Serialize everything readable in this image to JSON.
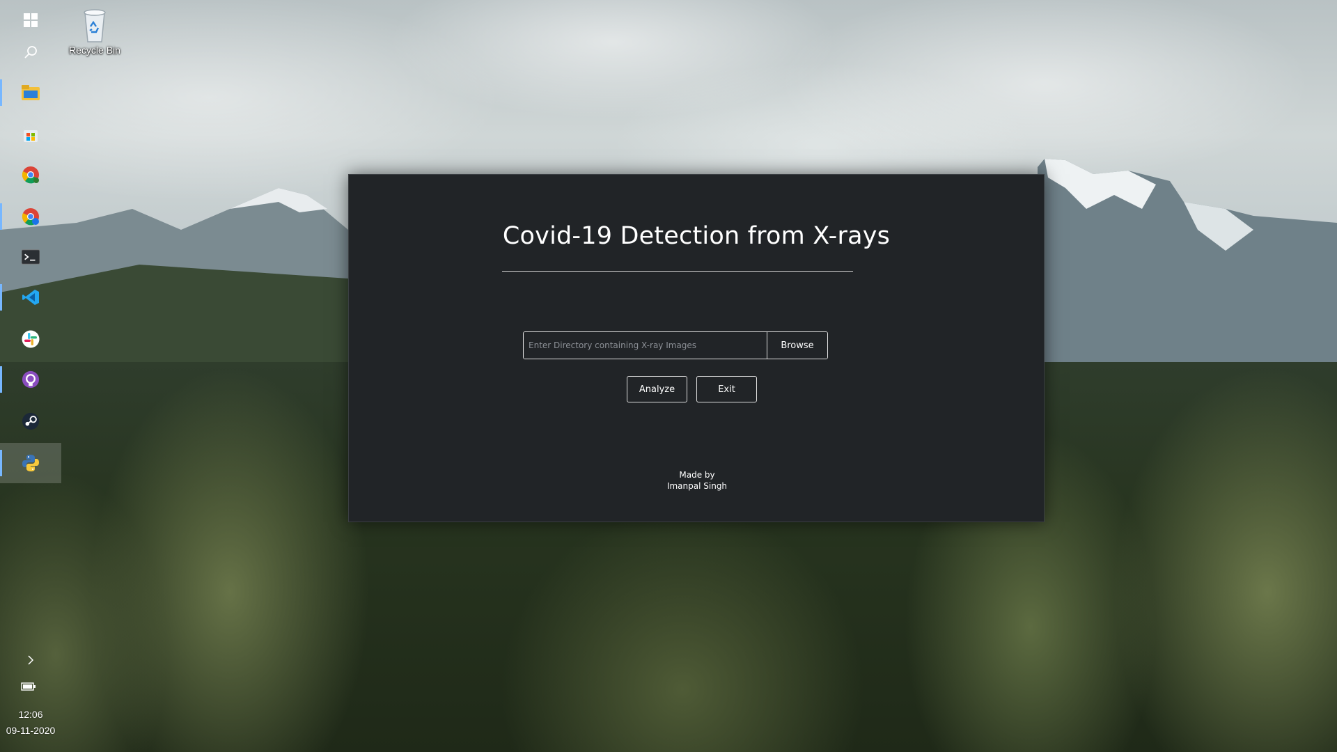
{
  "desktop": {
    "icons": [
      {
        "label": "Recycle Bin",
        "icon": "recycle-bin-icon"
      }
    ]
  },
  "taskbar": {
    "items": [
      {
        "name": "windows-start-icon",
        "running": false
      },
      {
        "name": "search-icon",
        "running": false
      },
      {
        "name": "file-explorer-icon",
        "running": true
      },
      {
        "name": "microsoft-store-icon",
        "running": false
      },
      {
        "name": "chrome-icon",
        "running": false
      },
      {
        "name": "chrome-profile-icon",
        "running": true
      },
      {
        "name": "terminal-icon",
        "running": false
      },
      {
        "name": "vscode-icon",
        "running": true
      },
      {
        "name": "slack-icon",
        "running": false
      },
      {
        "name": "github-desktop-icon",
        "running": true
      },
      {
        "name": "steam-icon",
        "running": false
      },
      {
        "name": "python-icon",
        "running": true,
        "active": true
      }
    ],
    "tray": {
      "chevron_icon": "chevron-right-icon",
      "battery_icon": "battery-icon",
      "time": "12:06",
      "date": "09-11-2020"
    }
  },
  "app": {
    "title": "Covid-19 Detection from X-rays",
    "directory_input": {
      "value": "",
      "placeholder": "Enter Directory containing X-ray Images"
    },
    "browse_label": "Browse",
    "analyze_label": "Analyze",
    "exit_label": "Exit",
    "credit_line1": "Made by",
    "credit_line2": "Imanpal Singh"
  }
}
